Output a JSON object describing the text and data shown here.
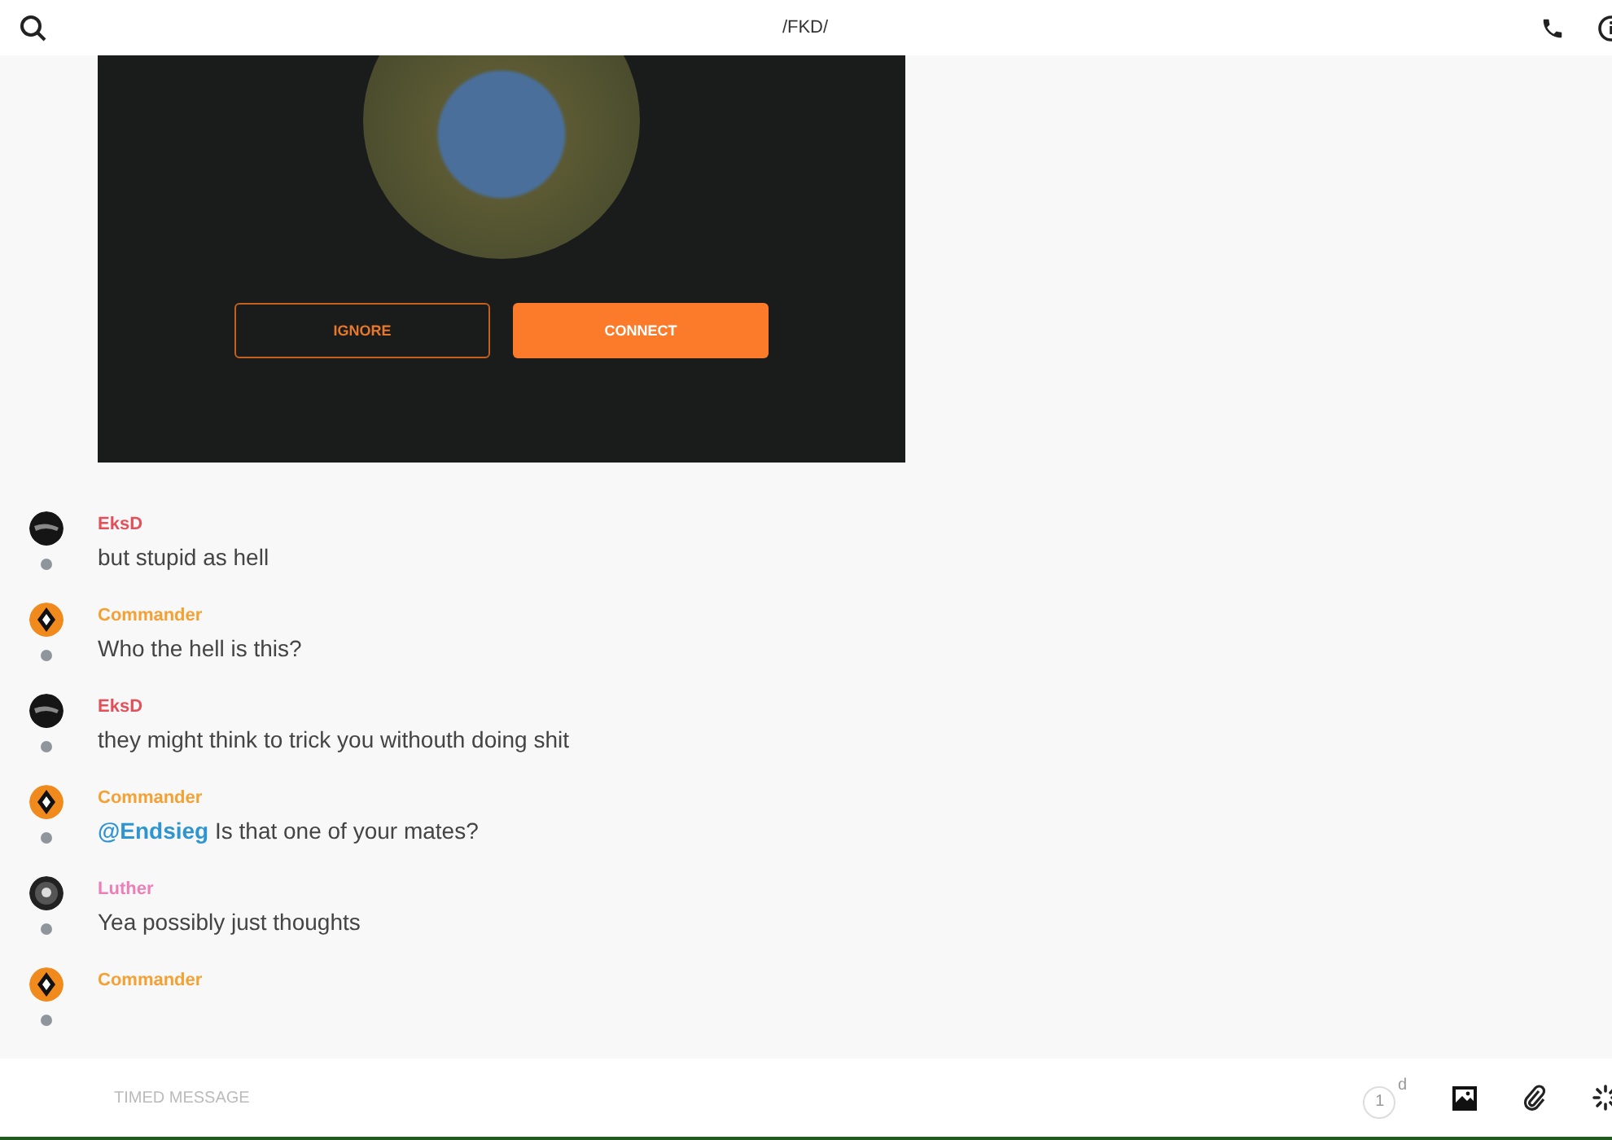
{
  "header": {
    "title": "/FKD/"
  },
  "invite_card": {
    "buttons": [
      {
        "label": "IGNORE",
        "kind": "outline"
      },
      {
        "label": "CONNECT",
        "kind": "filled"
      }
    ]
  },
  "messages": [
    {
      "author": "EksD",
      "color": "#e4505a",
      "kind": "dark",
      "text": "but stupid as hell"
    },
    {
      "author": "Commander",
      "color": "#f5a033",
      "kind": "orange",
      "text": "Who the hell is this?"
    },
    {
      "author": "EksD",
      "color": "#e4505a",
      "kind": "dark",
      "text": "they might think to trick you withouth doing shit"
    },
    {
      "author": "Commander",
      "color": "#f5a033",
      "kind": "orange",
      "mention": "@Endsieg",
      "text": "Is that one of your mates?"
    },
    {
      "author": "Luther",
      "color": "#ec7fb8",
      "kind": "grey",
      "text": "Yea possibly just thoughts"
    },
    {
      "author": "Commander",
      "color": "#f5a033",
      "kind": "orange"
    }
  ],
  "composer": {
    "placeholder": "TIMED MESSAGE",
    "timer_count": "1",
    "timer_unit": "d"
  }
}
